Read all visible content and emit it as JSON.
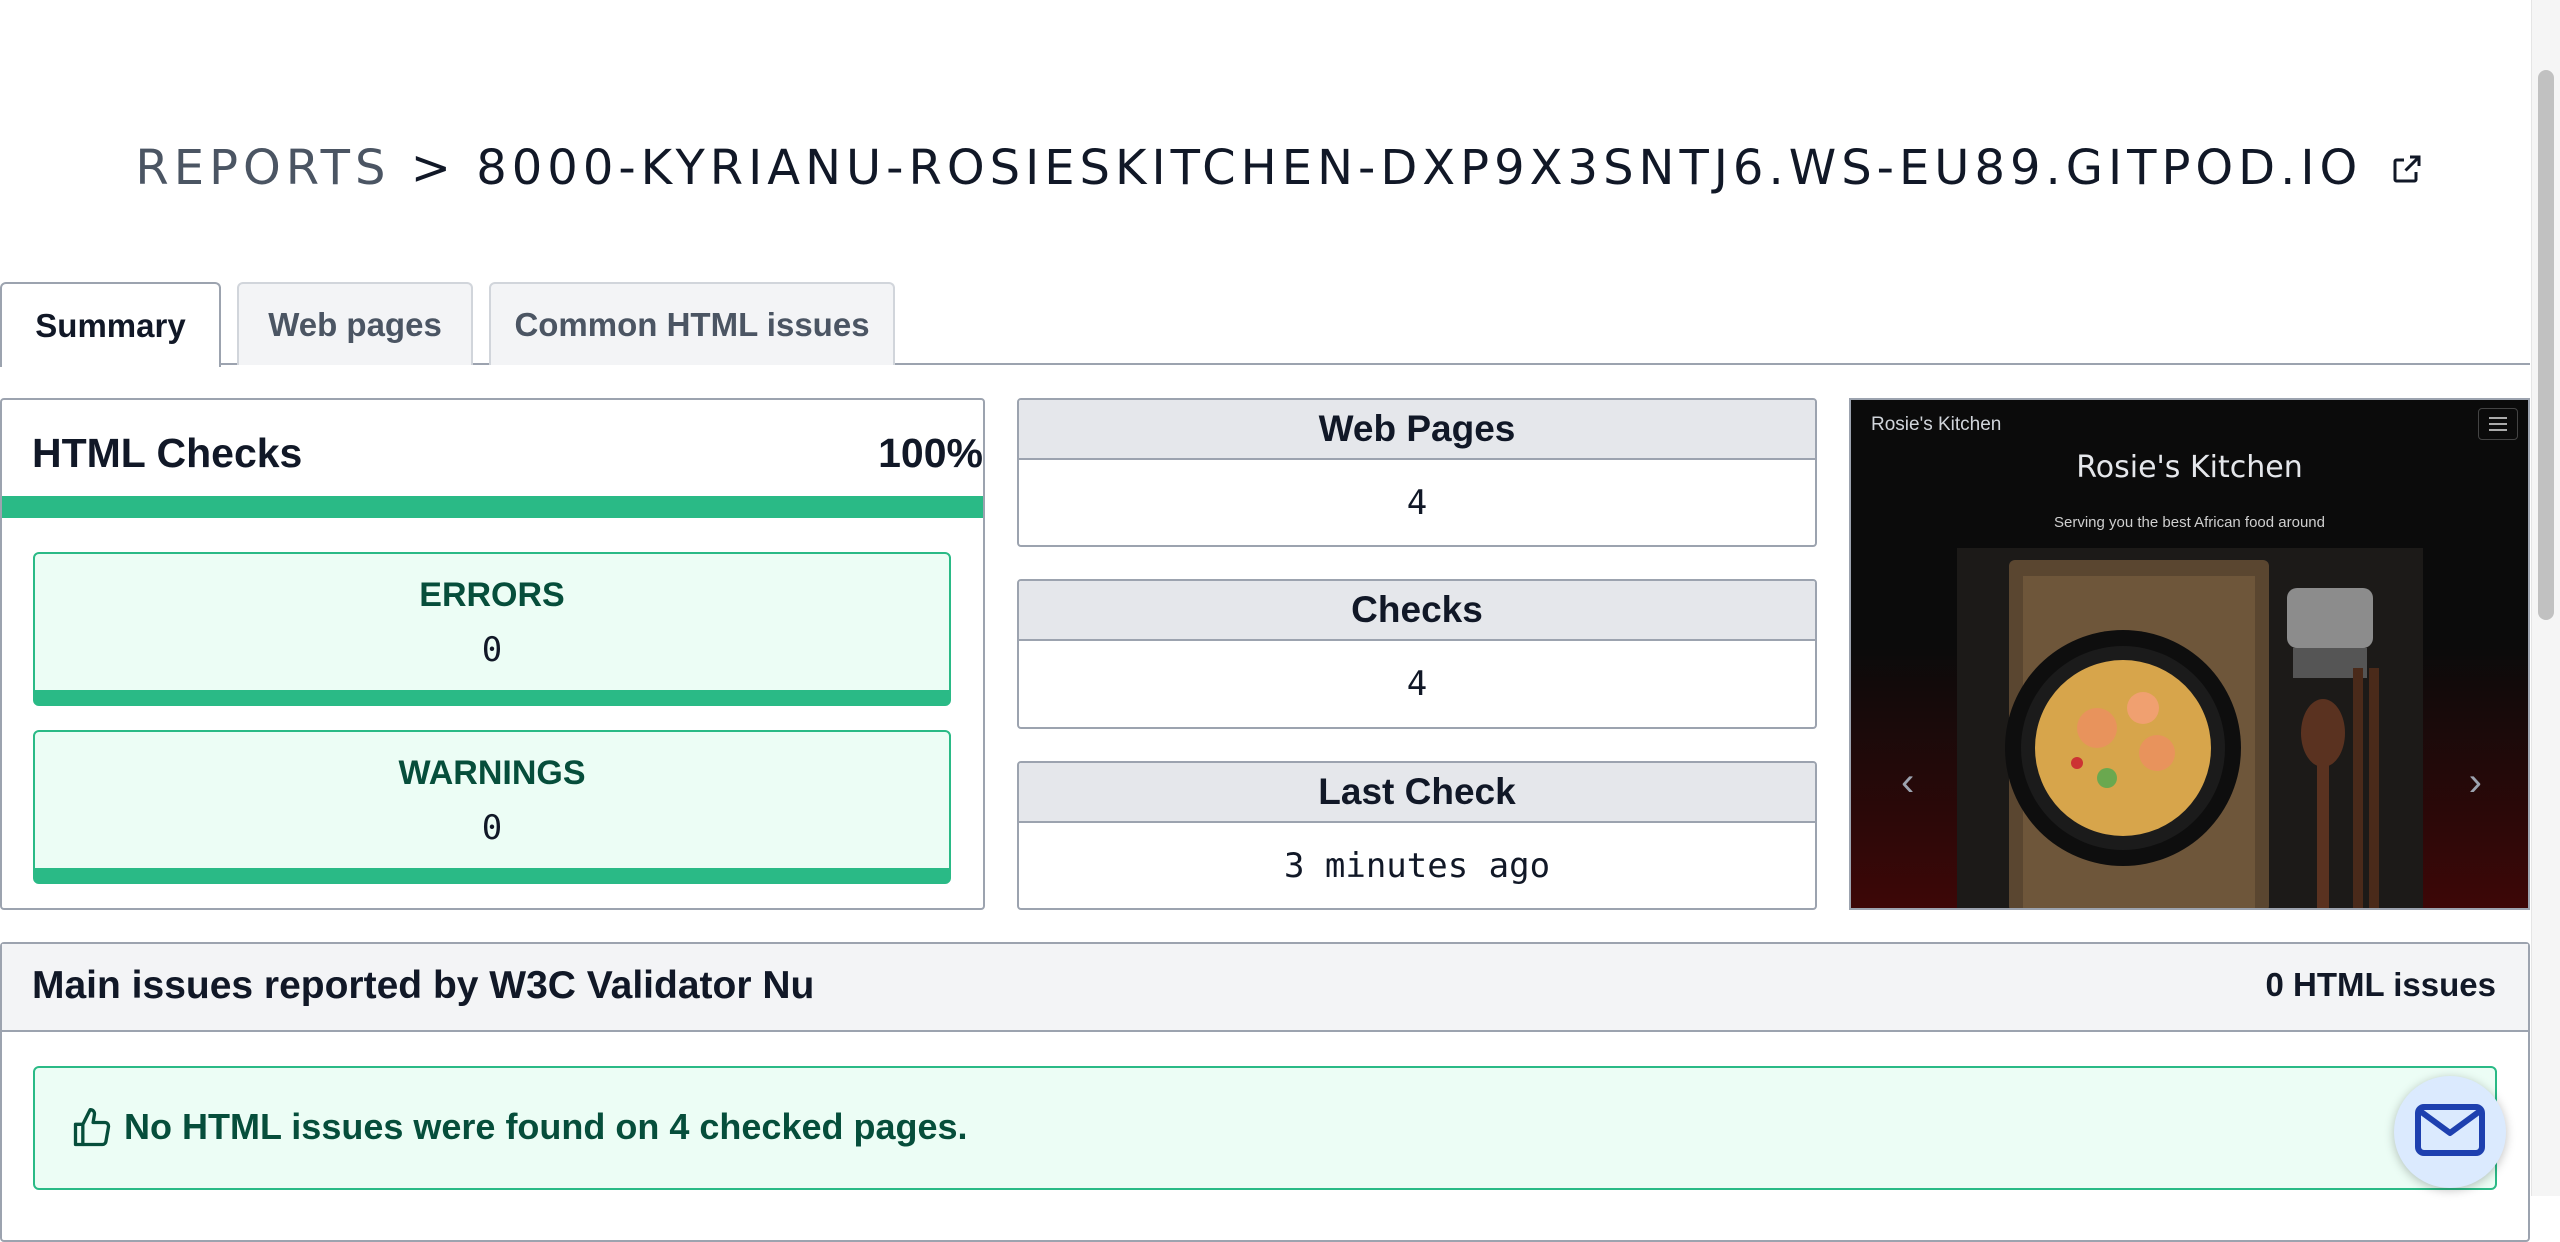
{
  "header": {
    "prefix": "REPORTS",
    "separator": ">",
    "site": "8000-KYRIANU-ROSIESKITCHEN-DXP9X3SNTJ6.WS-EU89.GITPOD.IO"
  },
  "tabs": {
    "summary": "Summary",
    "web_pages": "Web pages",
    "common_html_issues": "Common HTML issues"
  },
  "html_checks": {
    "title": "HTML Checks",
    "percent": "100%",
    "progress_fraction": 1.0,
    "errors": {
      "label": "ERRORS",
      "value": "0"
    },
    "warnings": {
      "label": "WARNINGS",
      "value": "0"
    }
  },
  "stats": {
    "web_pages": {
      "label": "Web Pages",
      "value": "4"
    },
    "checks": {
      "label": "Checks",
      "value": "4"
    },
    "last_check": {
      "label": "Last Check",
      "value": "3 minutes ago"
    }
  },
  "preview": {
    "brand": "Rosie's Kitchen",
    "title": "Rosie's Kitchen",
    "subtitle": "Serving you the best African food around",
    "prev_arrow": "‹",
    "next_arrow": "›"
  },
  "issues": {
    "title": "Main issues reported by W3C Validator Nu",
    "count": "0 HTML issues",
    "message": "No HTML issues were found on 4 checked pages."
  },
  "colors": {
    "success": "#2aba86",
    "success_bg": "#ecfdf5",
    "success_text": "#064e3b",
    "mail_icon": "#1e40af"
  }
}
